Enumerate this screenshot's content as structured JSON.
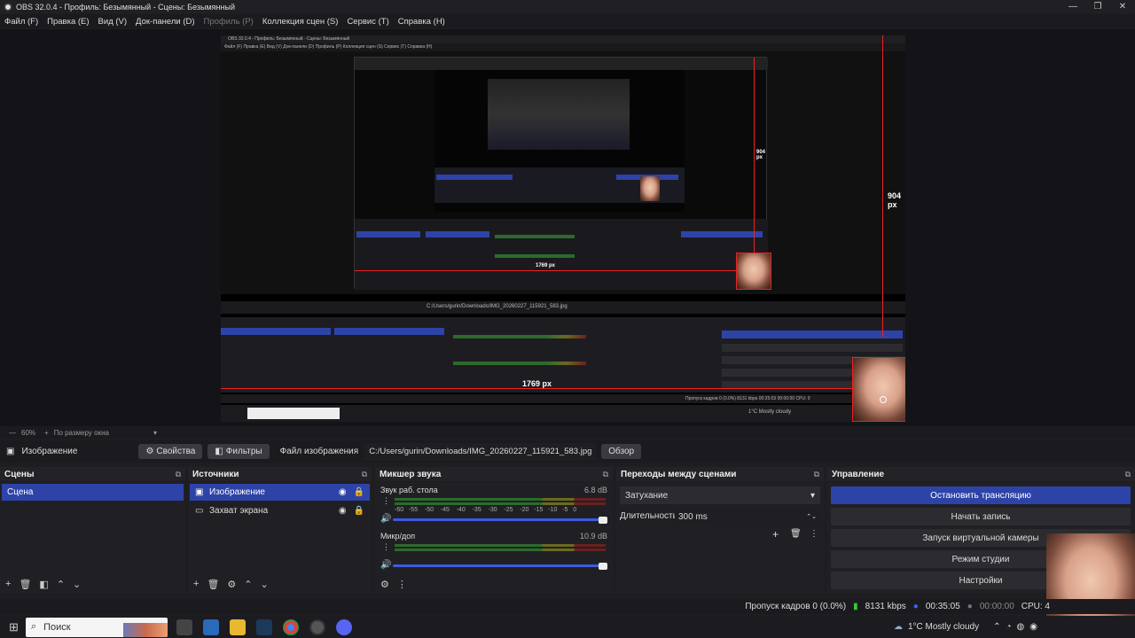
{
  "window": {
    "title": "OBS 32.0.4 - Профиль: Безымянный - Сцены: Безымянный",
    "minimize": "—",
    "maximize": "❐",
    "close": "✕"
  },
  "menu": [
    "Файл (F)",
    "Правка (E)",
    "Вид (V)",
    "Док-панели (D)",
    "Профиль (P)",
    "Коллекция сцен (S)",
    "Сервис (T)",
    "Справка (H)"
  ],
  "preview": {
    "inner_title": "OBS 32.0.4 - Профиль: Безымянный - Сцены: Безымянный",
    "inner_menu": "Файл (F)   Правка (E)   Вид (V)   Док-панели (D)   Профиль (P)   Коллекция сцен (S)   Сервис (T)   Справка (H)",
    "height_label": "904 px",
    "width_label": "1769 px",
    "inner_height_label": "904 px",
    "inner_width_label": "1769 px",
    "inner_file": "C:/Users/gurin/Downloads/IMG_20260227_115921_583.jpg",
    "inner_weather": "1°C Mostly cloudy",
    "inner_stats": "Пропуск кадров 0 (0.0%)   8131 kbps   00:25:03   00:00:00   CPU: 0"
  },
  "zoom": {
    "percent": "60%",
    "mode": "По размеру окна"
  },
  "source_toolbar": {
    "name": "Изображение",
    "properties": "Свойства",
    "filters": "Фильтры",
    "file_label": "Файл изображения",
    "file_path": "C:/Users/gurin/Downloads/IMG_20260227_115921_583.jpg",
    "browse": "Обзор"
  },
  "scenes": {
    "title": "Сцены",
    "items": [
      "Сцена"
    ]
  },
  "sources": {
    "title": "Источники",
    "items": [
      "Изображение",
      "Захват экрана"
    ]
  },
  "mixer": {
    "title": "Микшер звука",
    "channels": [
      {
        "name": "Звук раб. стола",
        "db": "6.8 dB",
        "level": 0.65
      },
      {
        "name": "Микр/доп",
        "db": "10.9 dB",
        "level": 0.6
      }
    ],
    "scale": [
      "-60",
      "-55",
      "-50",
      "-45",
      "-40",
      "-35",
      "-30",
      "-25",
      "-20",
      "-15",
      "-10",
      "-5",
      "0"
    ]
  },
  "transitions": {
    "title": "Переходы между сценами",
    "selected": "Затухание",
    "duration_label": "Длительность",
    "duration_value": "300 ms"
  },
  "controls": {
    "title": "Управление",
    "buttons": [
      "Остановить трансляцию",
      "Начать запись",
      "Запуск виртуальной камеры",
      "Режим студии",
      "Настройки"
    ]
  },
  "status": {
    "dropped": "Пропуск кадров 0 (0.0%)",
    "kbps": "8131 kbps",
    "stream_time": "00:35:05",
    "rec_time": "00:00:00",
    "cpu": "CPU: 4"
  },
  "taskbar": {
    "search": "Поиск",
    "weather": "1°C  Mostly cloudy"
  },
  "colors": {
    "accent": "#2e43a8",
    "selection_red": "#e22222"
  }
}
